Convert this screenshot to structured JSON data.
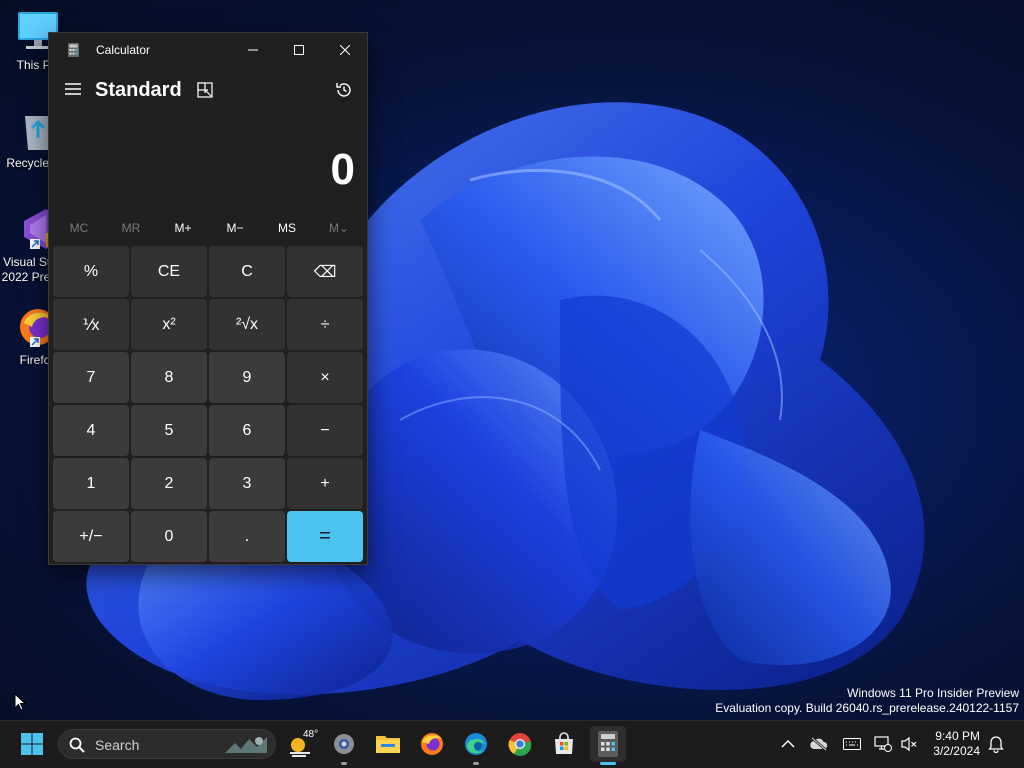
{
  "desktop": {
    "icons": [
      {
        "label": "This PC"
      },
      {
        "label": "Recycle Bin"
      },
      {
        "label": "Visual Studio\n2022 Preview"
      },
      {
        "label": "Firefox"
      }
    ],
    "watermark": {
      "line1": "Windows 11 Pro Insider Preview",
      "line2": "Evaluation copy. Build 26040.rs_prerelease.240122-1157"
    }
  },
  "calculator": {
    "window_title": "Calculator",
    "mode": "Standard",
    "display_value": "0",
    "memory_buttons": [
      {
        "label": "MC",
        "enabled": false
      },
      {
        "label": "MR",
        "enabled": false
      },
      {
        "label": "M+",
        "enabled": true
      },
      {
        "label": "M−",
        "enabled": true
      },
      {
        "label": "MS",
        "enabled": true
      },
      {
        "label": "M⌄",
        "enabled": false
      }
    ],
    "keys": [
      {
        "label": "%",
        "kind": "func",
        "name": "percent-key"
      },
      {
        "label": "CE",
        "kind": "func",
        "name": "clear-entry-key"
      },
      {
        "label": "C",
        "kind": "func",
        "name": "clear-key"
      },
      {
        "label": "⌫",
        "kind": "func",
        "name": "backspace-key"
      },
      {
        "label": "⅟x",
        "kind": "func",
        "name": "reciprocal-key"
      },
      {
        "label": "x²",
        "kind": "func",
        "name": "square-key"
      },
      {
        "label": "²√x",
        "kind": "func",
        "name": "square-root-key"
      },
      {
        "label": "÷",
        "kind": "func",
        "name": "divide-key"
      },
      {
        "label": "7",
        "kind": "num",
        "name": "digit-7-key"
      },
      {
        "label": "8",
        "kind": "num",
        "name": "digit-8-key"
      },
      {
        "label": "9",
        "kind": "num",
        "name": "digit-9-key"
      },
      {
        "label": "×",
        "kind": "func",
        "name": "multiply-key"
      },
      {
        "label": "4",
        "kind": "num",
        "name": "digit-4-key"
      },
      {
        "label": "5",
        "kind": "num",
        "name": "digit-5-key"
      },
      {
        "label": "6",
        "kind": "num",
        "name": "digit-6-key"
      },
      {
        "label": "−",
        "kind": "func",
        "name": "subtract-key"
      },
      {
        "label": "1",
        "kind": "num",
        "name": "digit-1-key"
      },
      {
        "label": "2",
        "kind": "num",
        "name": "digit-2-key"
      },
      {
        "label": "3",
        "kind": "num",
        "name": "digit-3-key"
      },
      {
        "label": "+",
        "kind": "func",
        "name": "add-key"
      },
      {
        "label": "+/−",
        "kind": "num",
        "name": "negate-key"
      },
      {
        "label": "0",
        "kind": "num",
        "name": "digit-0-key"
      },
      {
        "label": ".",
        "kind": "num",
        "name": "decimal-key"
      },
      {
        "label": "=",
        "kind": "equals",
        "name": "equals-key"
      }
    ]
  },
  "taskbar": {
    "search_placeholder": "Search",
    "weather_temp": "48°",
    "pinned": [
      "start-icon",
      "settings-icon",
      "file-explorer-icon",
      "firefox-icon",
      "edge-icon",
      "chrome-icon",
      "microsoft-store-icon",
      "calculator-icon"
    ],
    "active_app": "calculator-icon",
    "tray": [
      "chevron-up-icon",
      "onedrive-icon",
      "keyboard-icon",
      "network-icon",
      "volume-muted-icon",
      "notification-bell-icon"
    ],
    "clock": {
      "time": "9:40 PM",
      "date": "3/2/2024"
    }
  },
  "colors": {
    "accent": "#4cc2f0",
    "window_bg": "#202020",
    "key_bg": "#3b3b3b",
    "taskbar_bg": "#1c1c1c"
  }
}
